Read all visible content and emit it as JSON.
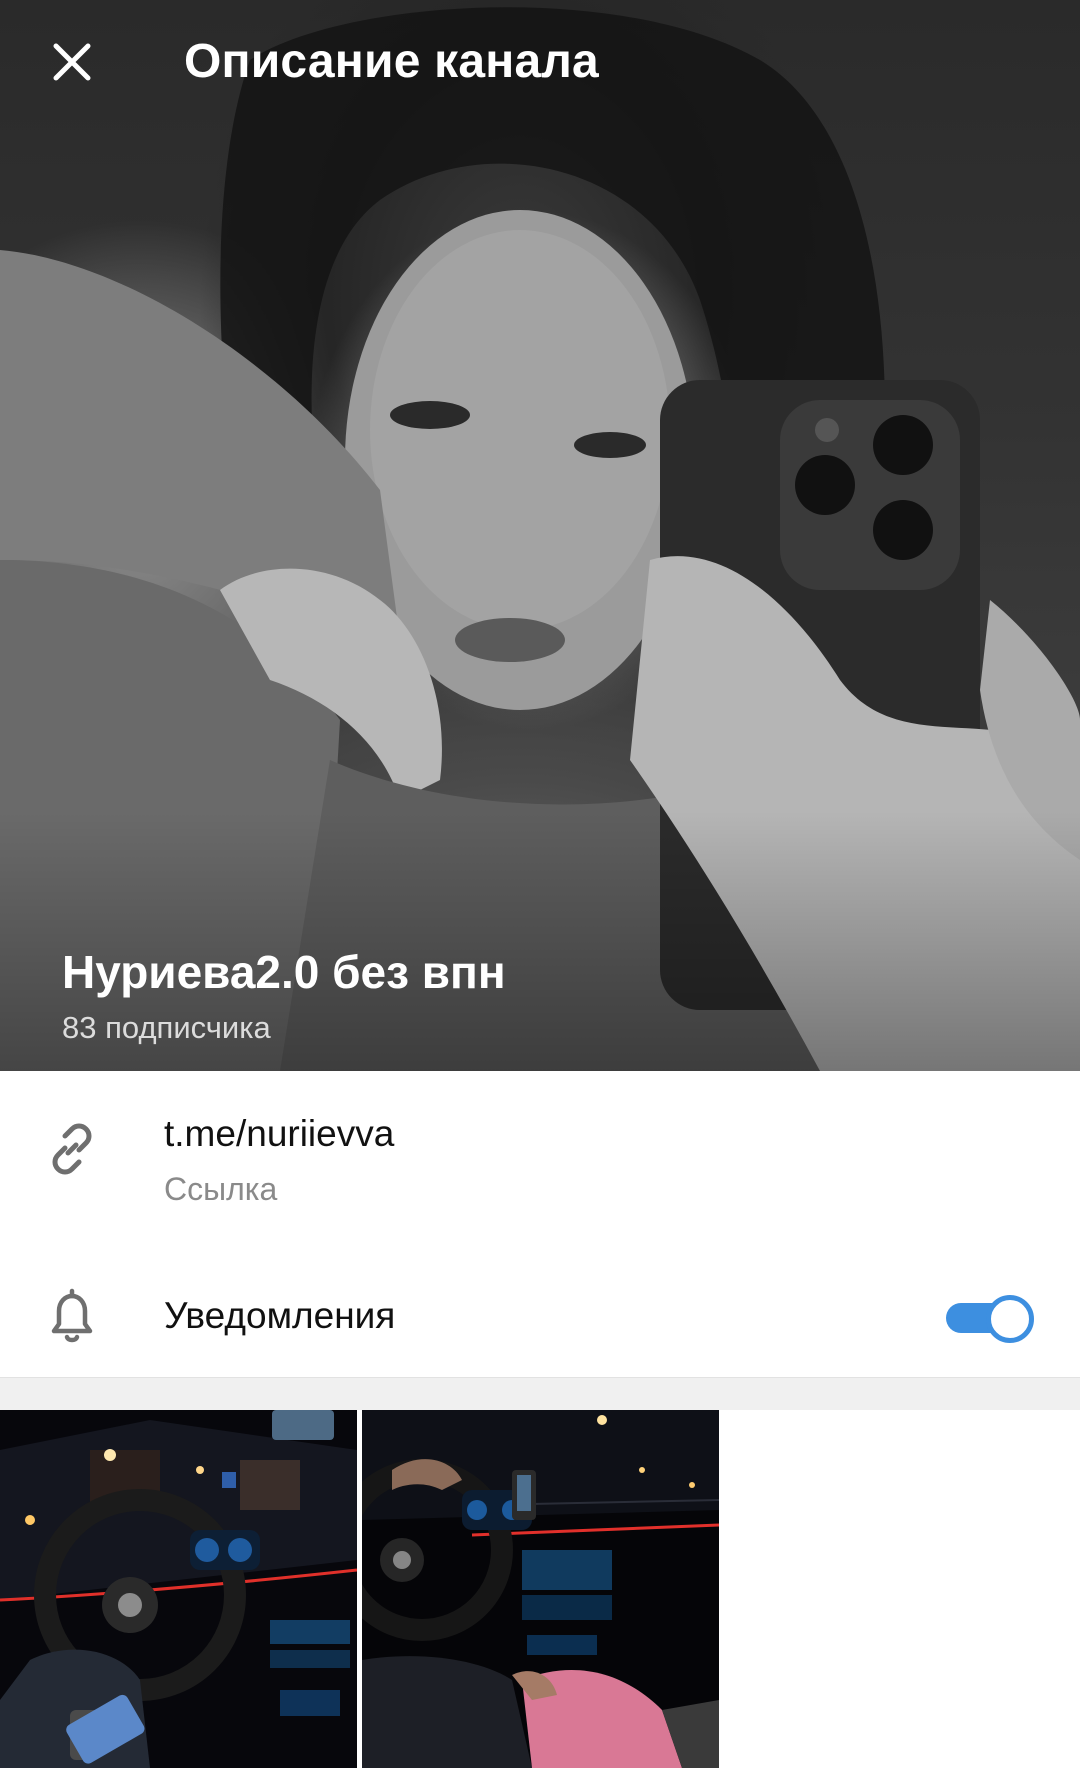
{
  "header": {
    "title": "Описание канала",
    "close_icon": "close-icon"
  },
  "channel": {
    "name": "Нуриева2.0 без впн",
    "subscribers": "83 подписчика"
  },
  "info": {
    "link_value": "t.me/nuriievva",
    "link_caption": "Ссылка",
    "link_icon": "link-icon",
    "notifications_label": "Уведомления",
    "notifications_icon": "bell-icon",
    "notifications_enabled": true
  },
  "colors": {
    "accent": "#3d8fe0",
    "text_primary": "#111111",
    "text_secondary": "#8a8a8a"
  },
  "media": {
    "items": [
      {
        "name": "media-thumb-car-interior-1"
      },
      {
        "name": "media-thumb-car-interior-2"
      }
    ]
  }
}
